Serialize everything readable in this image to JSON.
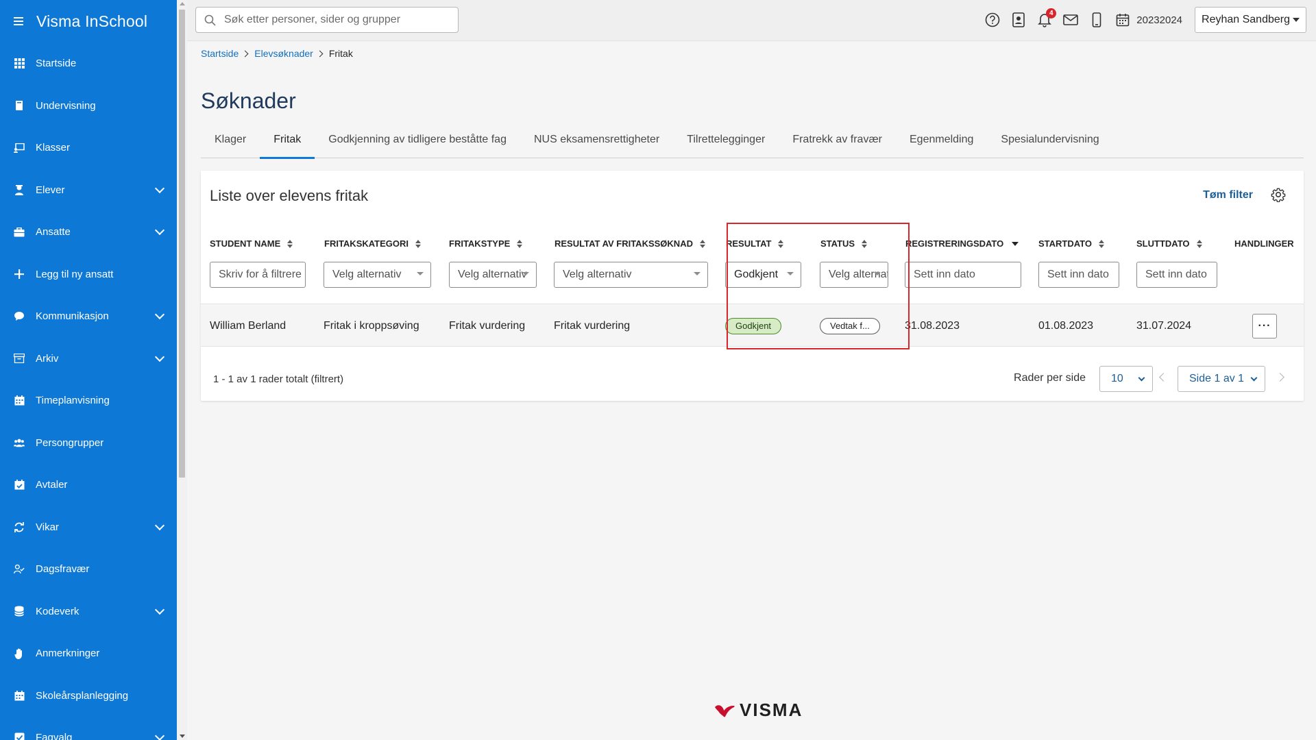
{
  "app": {
    "title": "Visma InSchool"
  },
  "sidebar": {
    "items": [
      {
        "label": "Startside",
        "icon": "grid-icon",
        "expandable": false
      },
      {
        "label": "Undervisning",
        "icon": "book-icon",
        "expandable": false
      },
      {
        "label": "Klasser",
        "icon": "classroom-icon",
        "expandable": false
      },
      {
        "label": "Elever",
        "icon": "student-icon",
        "expandable": true
      },
      {
        "label": "Ansatte",
        "icon": "briefcase-icon",
        "expandable": true
      },
      {
        "label": "Legg til ny ansatt",
        "icon": "plus-icon",
        "expandable": false
      },
      {
        "label": "Kommunikasjon",
        "icon": "chat-icon",
        "expandable": true
      },
      {
        "label": "Arkiv",
        "icon": "archive-icon",
        "expandable": true
      },
      {
        "label": "Timeplanvisning",
        "icon": "calendar-icon",
        "expandable": false
      },
      {
        "label": "Persongrupper",
        "icon": "group-icon",
        "expandable": false
      },
      {
        "label": "Avtaler",
        "icon": "calendar-check-icon",
        "expandable": false
      },
      {
        "label": "Vikar",
        "icon": "refresh-icon",
        "expandable": true
      },
      {
        "label": "Dagsfravær",
        "icon": "user-check-icon",
        "expandable": false
      },
      {
        "label": "Kodeverk",
        "icon": "database-icon",
        "expandable": true
      },
      {
        "label": "Anmerkninger",
        "icon": "hand-icon",
        "expandable": false
      },
      {
        "label": "Skoleårsplanlegging",
        "icon": "calendar-icon",
        "expandable": false
      },
      {
        "label": "Fagvalg",
        "icon": "checkbox-icon",
        "expandable": true
      }
    ]
  },
  "topbar": {
    "search_placeholder": "Søk etter personer, sider og grupper",
    "notification_count": "4",
    "school_year": "20232024",
    "user_name": "Reyhan Sandberg"
  },
  "breadcrumb": {
    "items": [
      "Startside",
      "Elevsøknader"
    ],
    "current": "Fritak"
  },
  "page_title": "Søknader",
  "tabs": [
    {
      "label": "Klager",
      "active": false
    },
    {
      "label": "Fritak",
      "active": true
    },
    {
      "label": "Godkjenning av tidligere beståtte fag",
      "active": false
    },
    {
      "label": "NUS eksamensrettigheter",
      "active": false
    },
    {
      "label": "Tilrettelegginger",
      "active": false
    },
    {
      "label": "Fratrekk av fravær",
      "active": false
    },
    {
      "label": "Egenmelding",
      "active": false
    },
    {
      "label": "Spesialundervisning",
      "active": false
    }
  ],
  "card": {
    "title": "Liste over elevens fritak",
    "clear_filter": "Tøm filter"
  },
  "table": {
    "columns": [
      "Student name",
      "Fritakskategori",
      "Fritakstype",
      "Resultat av fritakssøknad",
      "Resultat",
      "Status",
      "Registreringsdato",
      "Startdato",
      "Sluttdato",
      "Handlinger"
    ],
    "filters": {
      "student_name_placeholder": "Skriv for å filtrere",
      "fritakskategori": "Velg alternativ",
      "fritakstype": "Velg alternativ",
      "resultat_av_soknad": "Velg alternativ",
      "resultat": "Godkjent",
      "status": "Velg alternativ",
      "registreringsdato_placeholder": "Sett inn dato",
      "startdato_placeholder": "Sett inn dato",
      "sluttdato_placeholder": "Sett inn dato"
    },
    "rows": [
      {
        "student_name": "William Berland",
        "fritakskategori": "Fritak i kroppsøving",
        "fritakstype": "Fritak vurdering",
        "resultat_av_soknad": "Fritak vurdering",
        "resultat": "Godkjent",
        "status": "Vedtak f...",
        "registreringsdato": "31.08.2023",
        "startdato": "01.08.2023",
        "sluttdato": "31.07.2024",
        "actions": "···"
      }
    ]
  },
  "pagination": {
    "summary": "1 - 1 av 1 rader totalt (filtrert)",
    "rows_per_page_label": "Rader per side",
    "rows_per_page": "10",
    "page": "Side 1 av 1"
  },
  "footer": {
    "logo_text": "VISMA"
  },
  "colors": {
    "sidebar": "#0d78d6",
    "accent": "#0d78d6",
    "highlight": "#d9262c",
    "approved": "#d7ecc6"
  }
}
